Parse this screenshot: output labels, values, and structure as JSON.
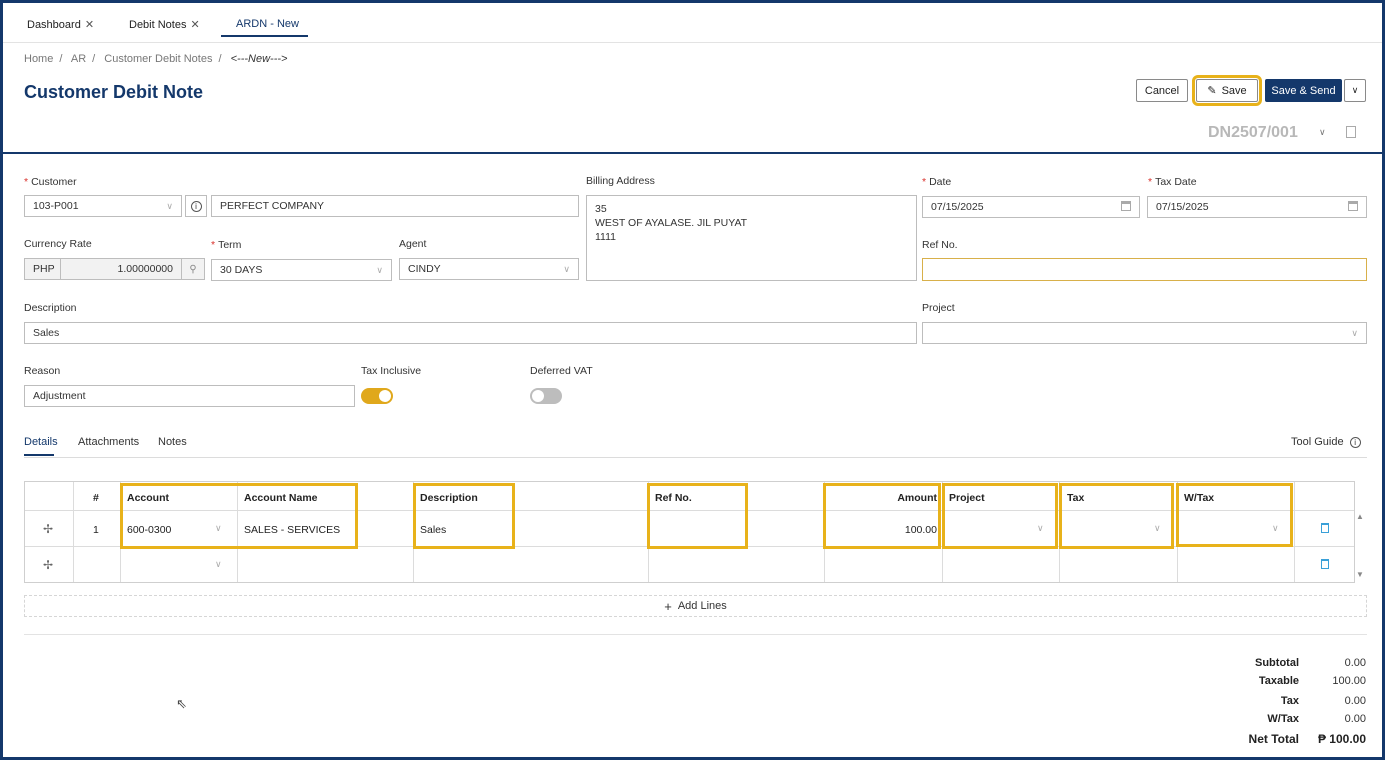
{
  "tabs": [
    {
      "label": "Dashboard"
    },
    {
      "label": "Debit Notes"
    },
    {
      "label": "ARDN - New"
    }
  ],
  "breadcrumb": [
    "Home",
    "AR",
    "Customer Debit Notes",
    "<---New--->"
  ],
  "page_title": "Customer Debit Note",
  "toolbar": {
    "cancel": "Cancel",
    "save": "Save",
    "save_send": "Save & Send"
  },
  "doc_number": "DN2507/001",
  "form": {
    "customer_label": "Customer",
    "customer_code": "103-P001",
    "customer_name": "PERFECT COMPANY",
    "billing_label": "Billing Address",
    "billing_line1": "35",
    "billing_line2": "WEST OF AYALASE. JIL PUYAT",
    "billing_line3": "1111",
    "date_label": "Date",
    "date_value": "07/15/2025",
    "tax_date_label": "Tax Date",
    "tax_date_value": "07/15/2025",
    "currency_label": "Currency Rate",
    "currency_code": "PHP",
    "currency_rate": "1.00000000",
    "term_label": "Term",
    "term_value": "30 DAYS",
    "agent_label": "Agent",
    "agent_value": "CINDY",
    "refno_label": "Ref No.",
    "refno_value": "",
    "description_label": "Description",
    "description_value": "Sales",
    "project_label": "Project",
    "project_value": "",
    "reason_label": "Reason",
    "reason_value": "Adjustment",
    "tax_inclusive_label": "Tax Inclusive",
    "tax_inclusive_on": true,
    "deferred_vat_label": "Deferred VAT",
    "deferred_vat_on": false
  },
  "subtabs": [
    "Details",
    "Attachments",
    "Notes"
  ],
  "tool_guide": "Tool Guide",
  "grid": {
    "headers": {
      "num": "#",
      "account": "Account",
      "account_name": "Account Name",
      "description": "Description",
      "ref_no": "Ref No.",
      "amount": "Amount",
      "project": "Project",
      "tax": "Tax",
      "wtax": "W/Tax"
    },
    "rows": [
      {
        "num": "1",
        "account": "600-0300",
        "account_name": "SALES - SERVICES",
        "description": "Sales",
        "ref_no": "",
        "amount": "100.00"
      }
    ]
  },
  "add_lines": "Add Lines",
  "totals": {
    "subtotal_label": "Subtotal",
    "subtotal": "0.00",
    "taxable_label": "Taxable",
    "taxable": "100.00",
    "tax_label": "Tax",
    "tax": "0.00",
    "wtax_label": "W/Tax",
    "wtax": "0.00",
    "net_label": "Net Total",
    "net": "₱ 100.00"
  },
  "colors": {
    "brand": "#14386b",
    "highlight": "#e8b21a",
    "toggle_on": "#e0a81c",
    "toggle_off": "#bdbdbd"
  }
}
